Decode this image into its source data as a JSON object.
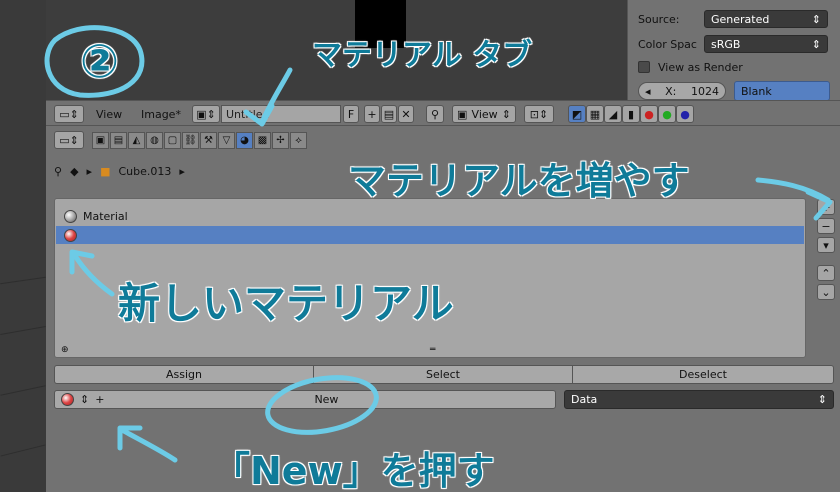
{
  "top_props": {
    "source_label": "Source:",
    "source_value": "Generated",
    "color_space_label": "Color Spac",
    "color_space_value": "sRGB",
    "view_as_render_label": "View as Render",
    "x_label": "X:",
    "x_value": "1024",
    "blank_label": "Blank"
  },
  "header": {
    "view_menu": "View",
    "image_menu": "Image*",
    "image_name": "Untitled",
    "fake_user": "F",
    "view_select": "View"
  },
  "breadcrumb": {
    "object": "Cube.013"
  },
  "slots": [
    {
      "label": "Material"
    },
    {
      "label": ""
    }
  ],
  "buttons": {
    "assign": "Assign",
    "select": "Select",
    "deselect": "Deselect",
    "new": "New",
    "data": "Data"
  },
  "annotations": {
    "step": "②",
    "material_tab": "マテリアル タブ",
    "add_material": "マテリアルを増やす",
    "new_material": "新しいマテリアル",
    "press_new": "「New」を押す"
  },
  "colors": {
    "annotation": "#0f7b99",
    "selected": "#5680c2",
    "panel": "#727272"
  }
}
